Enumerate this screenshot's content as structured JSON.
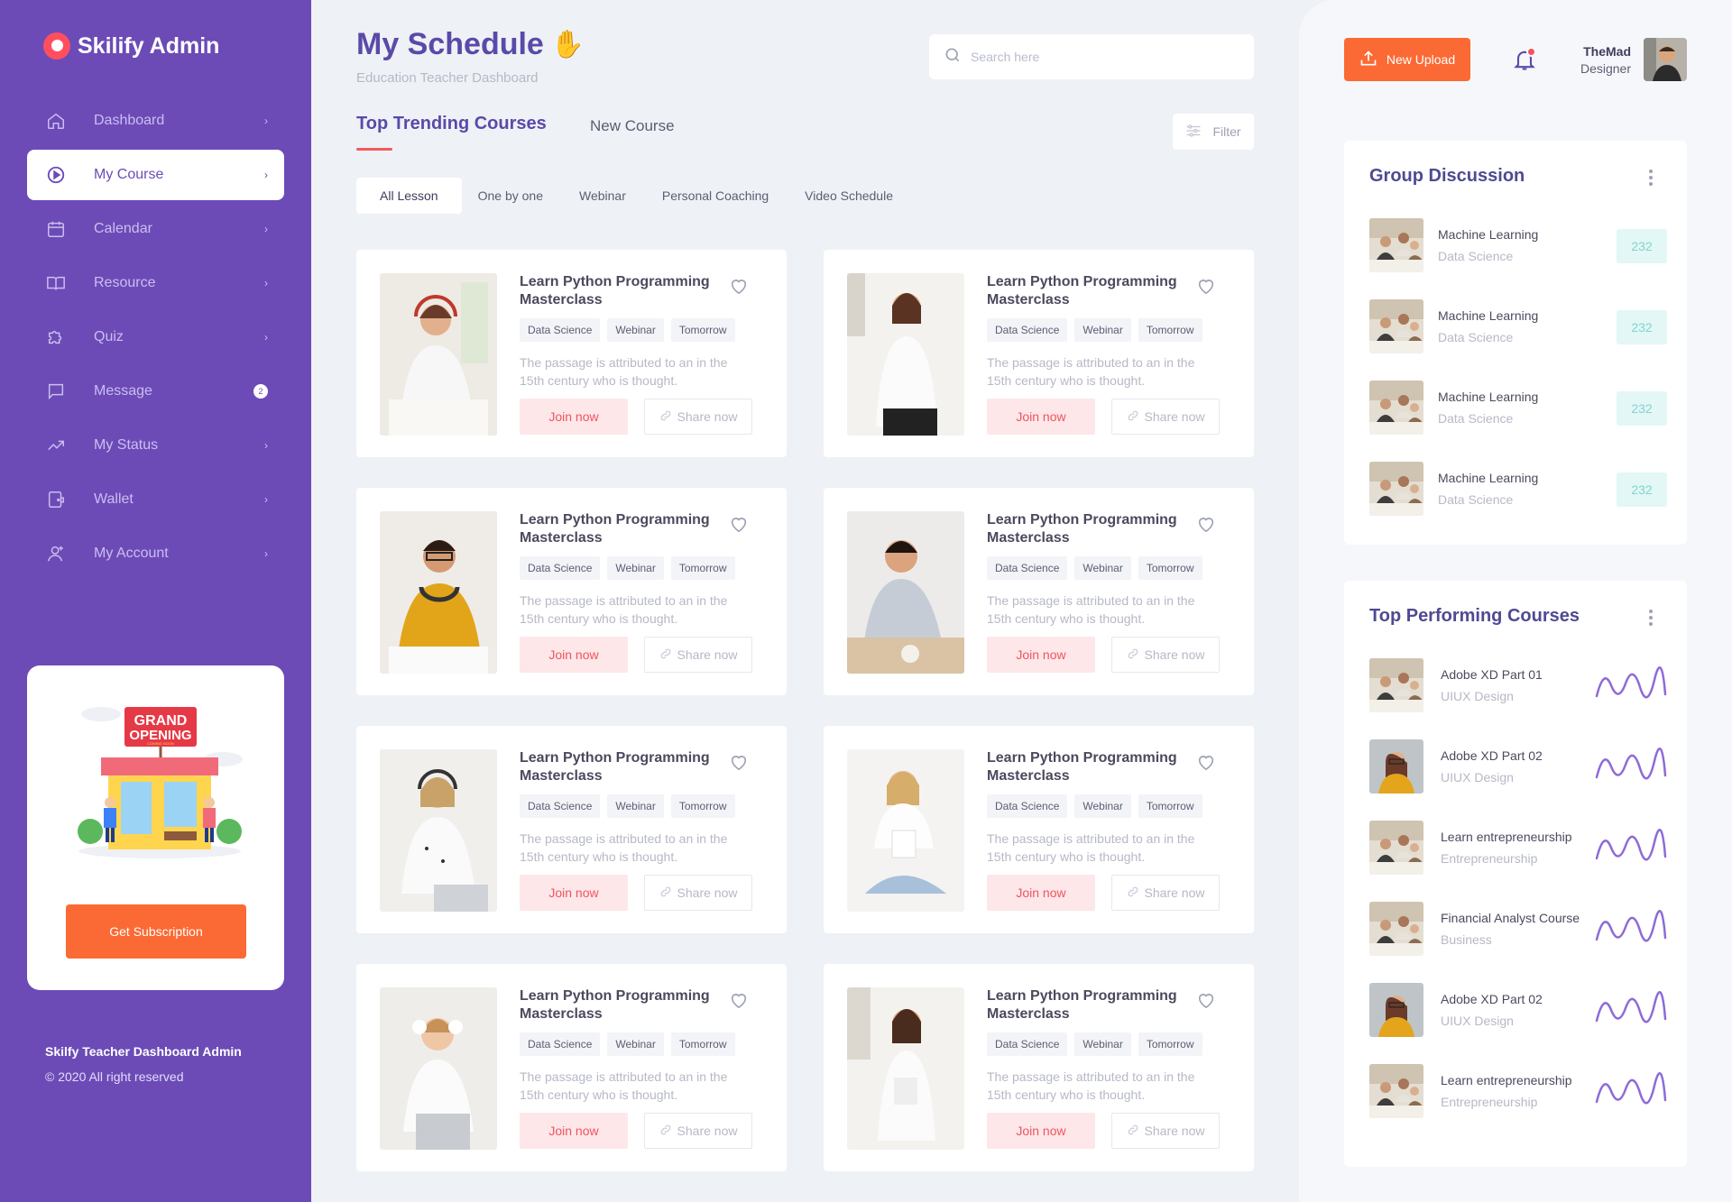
{
  "app": {
    "name": "Skilify Admin"
  },
  "sidebar": {
    "items": [
      {
        "label": "Dashboard",
        "icon": "home-icon",
        "active": false
      },
      {
        "label": "My Course",
        "icon": "play-circle-icon",
        "active": true
      },
      {
        "label": "Calendar",
        "icon": "calendar-icon",
        "active": false
      },
      {
        "label": "Resource",
        "icon": "book-icon",
        "active": false
      },
      {
        "label": "Quiz",
        "icon": "puzzle-icon",
        "active": false
      },
      {
        "label": "Message",
        "icon": "message-icon",
        "active": false,
        "badge": "2"
      },
      {
        "label": "My Status",
        "icon": "trending-up-icon",
        "active": false
      },
      {
        "label": "Wallet",
        "icon": "wallet-icon",
        "active": false
      },
      {
        "label": "My Account",
        "icon": "user-icon",
        "active": false
      }
    ],
    "promo": {
      "sign_top": "GRAND",
      "sign_bottom": "OPENING",
      "sign_small": "COMING SOON",
      "button": "Get Subscription"
    },
    "footer": {
      "title": "Skilfy Teacher Dashboard Admin",
      "copyright": "© 2020 All right reserved"
    }
  },
  "header": {
    "title": "My Schedule",
    "title_emoji": "✋",
    "subtitle": "Education Teacher Dashboard",
    "search_placeholder": "Search here"
  },
  "tabs": {
    "active": "Top Trending Courses",
    "other": "New Course",
    "filter": "Filter"
  },
  "chips": [
    "All Lesson",
    "One by one",
    "Webinar",
    "Personal Coaching",
    "Video Schedule"
  ],
  "courses": [
    {
      "title": "Learn Python Programming Masterclass",
      "tags": [
        "Data Science",
        "Webinar",
        "Tomorrow"
      ],
      "desc": "The passage is attributed to an  in the 15th century who is thought.",
      "join": "Join now",
      "share": "Share now"
    },
    {
      "title": "Learn Python Programming Masterclass",
      "tags": [
        "Data Science",
        "Webinar",
        "Tomorrow"
      ],
      "desc": "The passage is attributed to an  in the 15th century who is thought.",
      "join": "Join now",
      "share": "Share now"
    },
    {
      "title": "Learn Python Programming Masterclass",
      "tags": [
        "Data Science",
        "Webinar",
        "Tomorrow"
      ],
      "desc": "The passage is attributed to an  in the 15th century who is thought.",
      "join": "Join now",
      "share": "Share now"
    },
    {
      "title": "Learn Python Programming Masterclass",
      "tags": [
        "Data Science",
        "Webinar",
        "Tomorrow"
      ],
      "desc": "The passage is attributed to an  in the 15th century who is thought.",
      "join": "Join now",
      "share": "Share now"
    },
    {
      "title": "Learn Python Programming Masterclass",
      "tags": [
        "Data Science",
        "Webinar",
        "Tomorrow"
      ],
      "desc": "The passage is attributed to an  in the 15th century who is thought.",
      "join": "Join now",
      "share": "Share now"
    },
    {
      "title": "Learn Python Programming Masterclass",
      "tags": [
        "Data Science",
        "Webinar",
        "Tomorrow"
      ],
      "desc": "The passage is attributed to an  in the 15th century who is thought.",
      "join": "Join now",
      "share": "Share now"
    },
    {
      "title": "Learn Python Programming Masterclass",
      "tags": [
        "Data Science",
        "Webinar",
        "Tomorrow"
      ],
      "desc": "The passage is attributed to an  in the 15th century who is thought.",
      "join": "Join now",
      "share": "Share now"
    },
    {
      "title": "Learn Python Programming Masterclass",
      "tags": [
        "Data Science",
        "Webinar",
        "Tomorrow"
      ],
      "desc": "The passage is attributed to an  in the 15th century who is thought.",
      "join": "Join now",
      "share": "Share now"
    }
  ],
  "topbar": {
    "upload": "New Upload",
    "user_name": "TheMad",
    "user_role": "Designer"
  },
  "group_discussion": {
    "title": "Group Discussion",
    "items": [
      {
        "title": "Machine Learning",
        "subtitle": "Data Science",
        "count": "232"
      },
      {
        "title": "Machine Learning",
        "subtitle": "Data Science",
        "count": "232"
      },
      {
        "title": "Machine Learning",
        "subtitle": "Data Science",
        "count": "232"
      },
      {
        "title": "Machine Learning",
        "subtitle": "Data Science",
        "count": "232"
      }
    ]
  },
  "top_courses": {
    "title": "Top Performing Courses",
    "items": [
      {
        "title": "Adobe XD Part 01",
        "subtitle": "UIUX Design"
      },
      {
        "title": "Adobe XD Part 02",
        "subtitle": "UIUX Design"
      },
      {
        "title": "Learn entrepreneurship",
        "subtitle": "Entrepreneurship"
      },
      {
        "title": "Financial Analyst Course",
        "subtitle": "Business"
      },
      {
        "title": "Adobe XD Part 02",
        "subtitle": "UIUX Design"
      },
      {
        "title": "Learn entrepreneurship",
        "subtitle": "Entrepreneurship"
      }
    ]
  },
  "colors": {
    "sidebar": "#6c4bb7",
    "accent_orange": "#fb6a34",
    "accent_red": "#f0545f",
    "title_purple": "#5a4aa8",
    "teal_badge": "#e2f7f6"
  }
}
